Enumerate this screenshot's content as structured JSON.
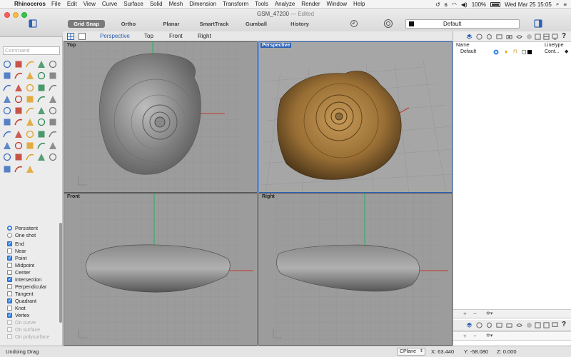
{
  "menubar": {
    "app": "Rhinoceros",
    "items": [
      "File",
      "Edit",
      "View",
      "Curve",
      "Surface",
      "Solid",
      "Mesh",
      "Dimension",
      "Transform",
      "Tools",
      "Analyze",
      "Render",
      "Window",
      "Help"
    ],
    "battery": "100%",
    "clock": "Wed Mar 25  15:05"
  },
  "window": {
    "title": "GSM_47200",
    "title_status": " — Edited",
    "toolbar": [
      "Grid Snap",
      "Ortho",
      "Planar",
      "SmartTrack",
      "Gumball",
      "History"
    ],
    "layer_selector": "Default"
  },
  "command": {
    "placeholder": "Command"
  },
  "osnap": {
    "mode": [
      {
        "label": "Persistent",
        "checked": true
      },
      {
        "label": "One shot",
        "checked": false
      }
    ],
    "items": [
      {
        "label": "End",
        "checked": true,
        "dim": false
      },
      {
        "label": "Near",
        "checked": false,
        "dim": false
      },
      {
        "label": "Point",
        "checked": true,
        "dim": false
      },
      {
        "label": "Midpoint",
        "checked": false,
        "dim": false
      },
      {
        "label": "Center",
        "checked": false,
        "dim": false
      },
      {
        "label": "Intersection",
        "checked": true,
        "dim": false
      },
      {
        "label": "Perpendicular",
        "checked": false,
        "dim": false
      },
      {
        "label": "Tangent",
        "checked": false,
        "dim": false
      },
      {
        "label": "Quadrant",
        "checked": true,
        "dim": false
      },
      {
        "label": "Knot",
        "checked": false,
        "dim": false
      },
      {
        "label": "Vertex",
        "checked": true,
        "dim": false
      },
      {
        "label": "On curve",
        "checked": false,
        "dim": true
      },
      {
        "label": "On surface",
        "checked": false,
        "dim": true
      },
      {
        "label": "On polysurface",
        "checked": false,
        "dim": true
      }
    ]
  },
  "viewport_tabs": [
    "Perspective",
    "Top",
    "Front",
    "Right"
  ],
  "viewports": {
    "top": "Top",
    "perspective": "Perspective",
    "front": "Front",
    "right": "Right"
  },
  "layers_panel": {
    "col_name": "Name",
    "col_linetype": "Linetype",
    "row_name": "Default",
    "row_linetype": "Cont...",
    "add": "+",
    "remove": "−"
  },
  "status": {
    "message": "Undoing Drag",
    "cplane": "CPlane",
    "x": "X: 63.440",
    "y": "Y: -58.080",
    "z": "Z: 0.000"
  },
  "colors": {
    "active_tab": "#2e62b5",
    "checkbox": "#3a86e8",
    "axis_x": "#c0392b",
    "axis_y": "#27ae60"
  }
}
